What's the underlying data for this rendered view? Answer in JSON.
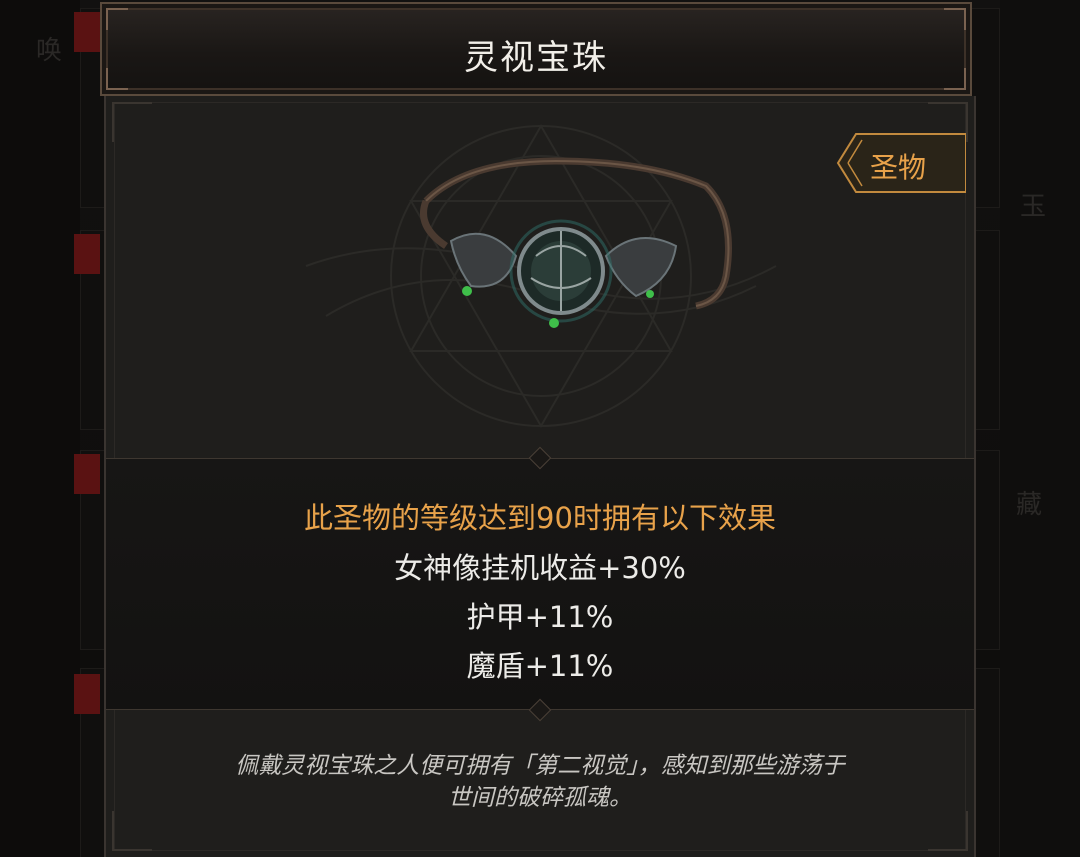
{
  "dialog": {
    "title": "灵视宝珠",
    "rarity": "圣物",
    "item_icon": "eye-orb-amulet-icon"
  },
  "effects": {
    "heading": "此圣物的等级达到90时拥有以下效果",
    "lines": [
      "女神像挂机收益+30%",
      "护甲+11%",
      "魔盾+11%"
    ]
  },
  "flavor": {
    "line1": "佩戴灵视宝珠之人便可拥有「第二视觉」，感知到那些游荡于",
    "line2": "世间的破碎孤魂。"
  },
  "background": {
    "left_char": "唤",
    "right_char_1": "玉",
    "right_char_2": "藏"
  },
  "colors": {
    "accent_orange": "#e8a24a",
    "text_white": "#ecebe8",
    "panel_bg": "#1f1e1c"
  }
}
